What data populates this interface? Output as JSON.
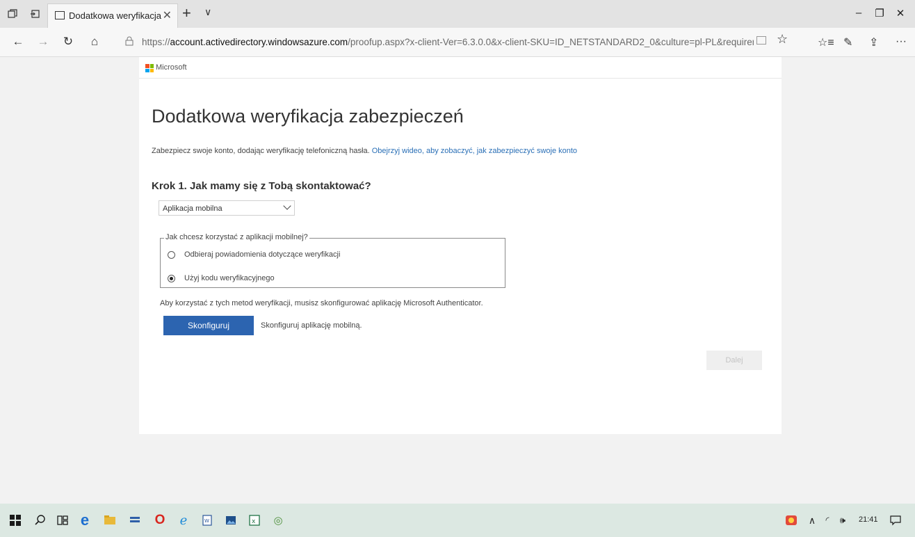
{
  "browser": {
    "tab_title": "Dodatkowa weryfikacja",
    "url_prefix": "https://",
    "url_host": "account.activedirectory.windowsazure.com",
    "url_path": "/proofup.aspx?x-client-Ver=6.3.0.0&x-client-SKU=ID_NETSTANDARD2_0&culture=pl-PL&requirement=App"
  },
  "page": {
    "brand": "Microsoft",
    "title": "Dodatkowa weryfikacja zabezpieczeń",
    "intro_text": "Zabezpiecz swoje konto, dodając weryfikację telefoniczną hasła.",
    "intro_link": "Obejrzyj wideo, aby zobaczyć, jak zabezpieczyć swoje konto",
    "step_heading": "Krok 1. Jak mamy się z Tobą skontaktować?",
    "method_select": {
      "value": "Aplikacja mobilna"
    },
    "app_usage": {
      "legend": "Jak chcesz korzystać z aplikacji mobilnej?",
      "options": [
        {
          "label": "Odbieraj powiadomienia dotyczące weryfikacji",
          "checked": false
        },
        {
          "label": "Użyj kodu weryfikacyjnego",
          "checked": true
        }
      ]
    },
    "authenticator_note": "Aby korzystać z tych metod weryfikacji, musisz skonfigurować aplikację Microsoft Authenticator.",
    "configure_button": "Skonfiguruj",
    "configure_desc": "Skonfiguruj aplikację mobilną.",
    "next_button": "Dalej"
  },
  "taskbar": {
    "clock": "21:41"
  },
  "colors": {
    "primary_button": "#2c64b0",
    "link": "#2a6fb6",
    "taskbar_bg": "#dce8e2"
  }
}
